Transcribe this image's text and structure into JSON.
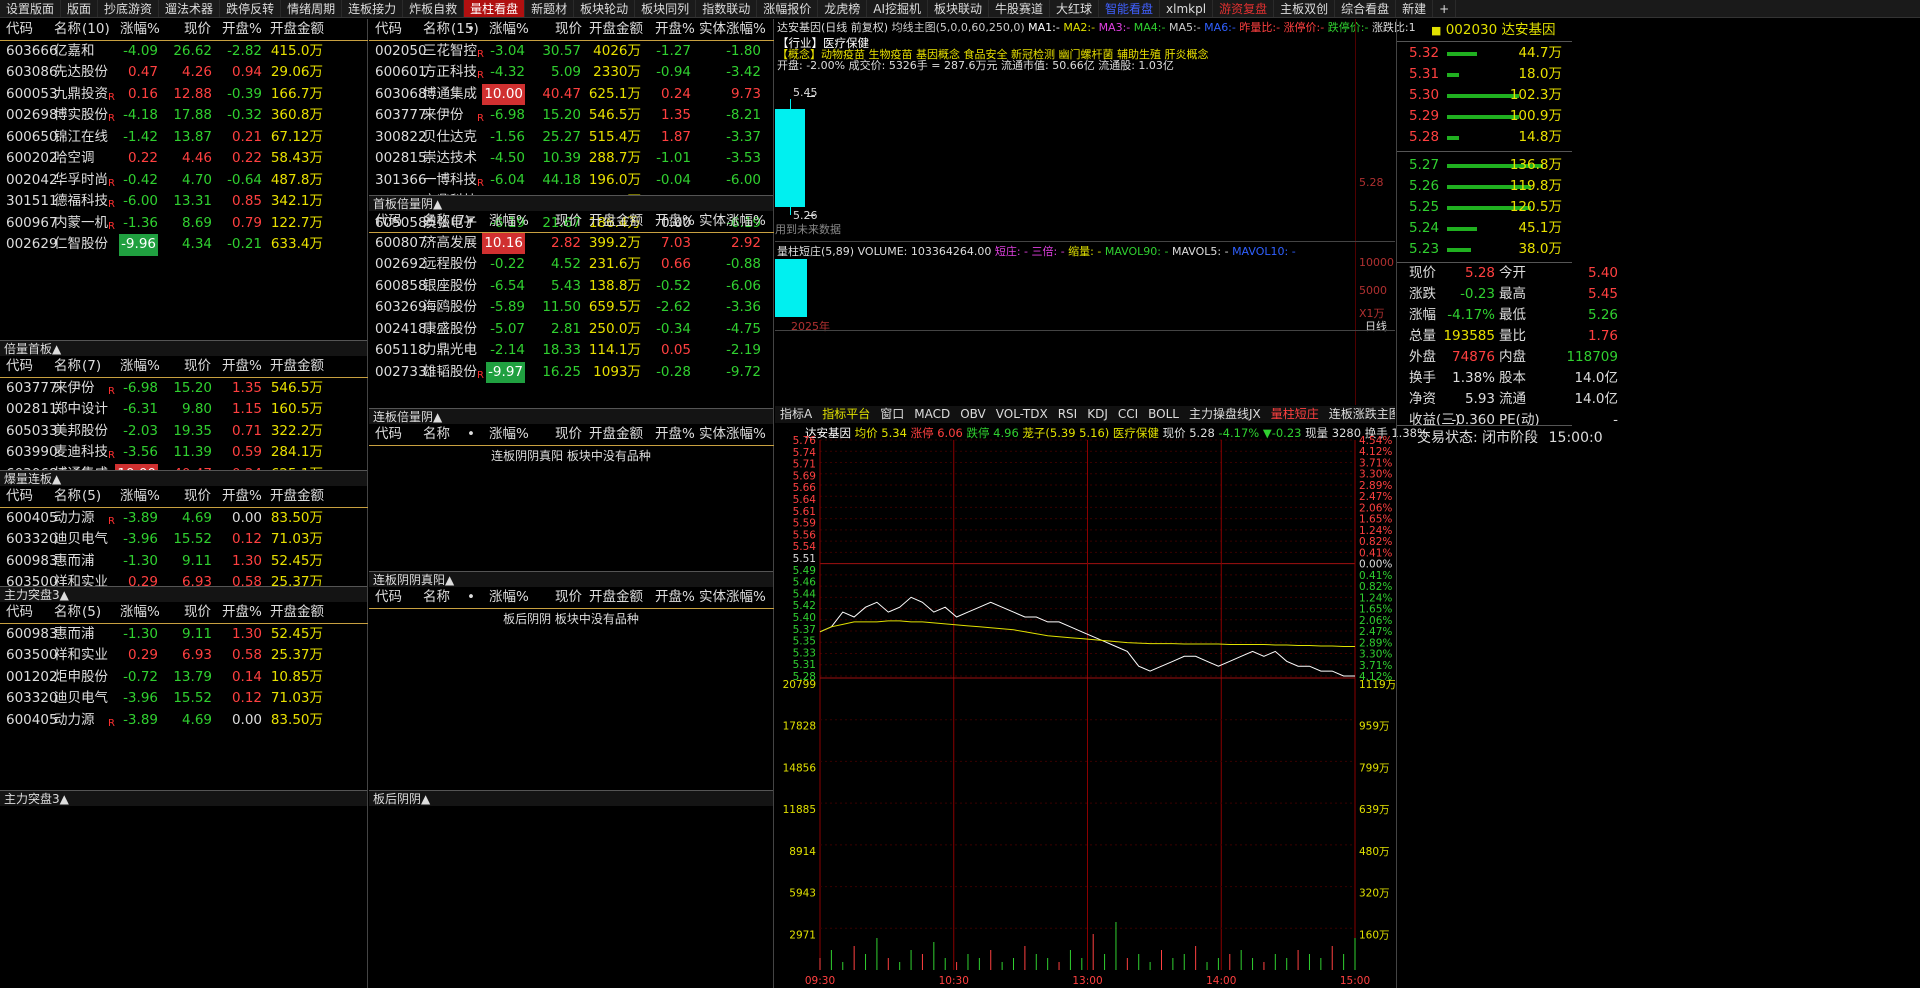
{
  "topbar": {
    "tabs": [
      "设置版面",
      "版面",
      "抄底游资",
      "遛法术器",
      "跌停反转",
      "情绪周期",
      "连板接力",
      "炸板自救",
      "量柱看盘",
      "新题材",
      "板块轮动",
      "板块同列",
      "指数联动",
      "涨幅报价",
      "龙虎榜",
      "AI挖掘机",
      "板块联动",
      "牛股赛道",
      "大红球",
      "智能看盘",
      "xlmkpl",
      "游资复盘",
      "主板双创",
      "综合看盘",
      "新建",
      "+"
    ]
  },
  "hdr": {
    "code": "代码",
    "name": "名称",
    "chg": "涨幅%",
    "price": "现价",
    "open": "开盘%",
    "amt": "开盘金额",
    "body": "实体涨幅%",
    "dot": "•"
  },
  "p1": {
    "count": "(10)",
    "rows": [
      [
        "603666",
        "亿嘉和",
        "",
        "-4.09",
        "26.62",
        "-2.82",
        "415.0万"
      ],
      [
        "603086",
        "先达股份",
        "",
        "0.47",
        "4.26",
        "0.94",
        "29.06万"
      ],
      [
        "600053",
        "九鼎投资",
        "R",
        "0.16",
        "12.88",
        "-0.39",
        "166.7万"
      ],
      [
        "002698",
        "博实股份",
        "R",
        "-4.18",
        "17.88",
        "-0.32",
        "360.8万"
      ],
      [
        "600650",
        "锦江在线",
        "",
        "-1.42",
        "13.87",
        "0.21",
        "67.12万"
      ],
      [
        "600202",
        "哈空调",
        "",
        "0.22",
        "4.46",
        "0.22",
        "58.43万"
      ],
      [
        "002042",
        "华孚时尚",
        "R",
        "-0.42",
        "4.70",
        "-0.64",
        "487.8万"
      ],
      [
        "301511",
        "德福科技",
        "R",
        "-6.00",
        "13.31",
        "0.85",
        "342.1万"
      ],
      [
        "600967",
        "内蒙一机",
        "R",
        "-1.36",
        "8.69",
        "0.79",
        "122.7万"
      ],
      [
        "002629",
        "仁智股份",
        "",
        "-9.96",
        "4.34",
        "-0.21",
        "633.4万"
      ]
    ]
  },
  "p2": {
    "title": "倍量首板▲",
    "count": "(7)",
    "rows": [
      [
        "603777",
        "来伊份",
        "R",
        "-6.98",
        "15.20",
        "1.35",
        "546.5万"
      ],
      [
        "002811",
        "郑中设计",
        "",
        "-6.31",
        "9.80",
        "1.15",
        "160.5万"
      ],
      [
        "605033",
        "美邦股份",
        "",
        "-2.03",
        "19.35",
        "0.71",
        "322.2万"
      ],
      [
        "603990",
        "麦迪科技",
        "R",
        "-3.56",
        "11.39",
        "0.59",
        "284.1万"
      ],
      [
        "603068",
        "博通集成",
        "",
        "10.00",
        "40.47",
        "0.24",
        "625.1万"
      ]
    ]
  },
  "p3": {
    "title": "爆量连板▲",
    "count": "(5)",
    "rows": [
      [
        "600405",
        "动力源",
        "R",
        "-3.89",
        "4.69",
        "0.00",
        "83.50万"
      ],
      [
        "603320",
        "迪贝电气",
        "",
        "-3.96",
        "15.52",
        "0.12",
        "71.03万"
      ],
      [
        "600983",
        "惠而浦",
        "",
        "-1.30",
        "9.11",
        "1.30",
        "52.45万"
      ],
      [
        "603500",
        "祥和实业",
        "",
        "0.29",
        "6.93",
        "0.58",
        "25.37万"
      ]
    ]
  },
  "p4": {
    "title": "主力突盘3▲",
    "count": "(5)",
    "rows": [
      [
        "600983",
        "惠而浦",
        "",
        "-1.30",
        "9.11",
        "1.30",
        "52.45万"
      ],
      [
        "603500",
        "祥和实业",
        "",
        "0.29",
        "6.93",
        "0.58",
        "25.37万"
      ],
      [
        "001202",
        "炬申股份",
        "",
        "-0.72",
        "13.79",
        "0.14",
        "10.85万"
      ],
      [
        "603320",
        "迪贝电气",
        "",
        "-3.96",
        "15.52",
        "0.12",
        "71.03万"
      ],
      [
        "600405",
        "动力源",
        "R",
        "-3.89",
        "4.69",
        "0.00",
        "83.50万"
      ]
    ]
  },
  "p4b": {
    "title": "主力突盘3▲"
  },
  "m1": {
    "count": "(15)",
    "rows": [
      [
        "002050",
        "三花智控",
        "R",
        "-3.04",
        "30.57",
        "4026万",
        "-1.27",
        "-1.80"
      ],
      [
        "600601",
        "方正科技",
        "R",
        "-4.32",
        "5.09",
        "2330万",
        "-0.94",
        "-3.42"
      ],
      [
        "603068",
        "博通集成",
        "",
        "10.00",
        "40.47",
        "625.1万",
        "0.24",
        "9.73"
      ],
      [
        "603777",
        "来伊份",
        "R",
        "-6.98",
        "15.20",
        "546.5万",
        "1.35",
        "-8.21"
      ],
      [
        "300822",
        "贝仕达克",
        "",
        "-1.56",
        "25.27",
        "515.4万",
        "1.87",
        "-3.37"
      ],
      [
        "002815",
        "崇达技术",
        "",
        "-4.50",
        "10.39",
        "288.7万",
        "-1.01",
        "-3.53"
      ],
      [
        "301366",
        "一博科技",
        "R",
        "-6.04",
        "44.18",
        "196.0万",
        "-0.04",
        "-6.00"
      ],
      [
        "002552",
        "宝鼎科技",
        "R",
        "-8.47",
        "14.70",
        "192.1万",
        "-1.06",
        "-7.49"
      ],
      [
        "605058",
        "澳弘电子",
        "",
        "-6.19",
        "21.67",
        "186.4万",
        "0.00",
        "-6.19"
      ]
    ]
  },
  "m2": {
    "title": "首板倍量阴▲",
    "count": "(7)",
    "rows": [
      [
        "600807",
        "济高发展",
        "",
        "10.16",
        "2.82",
        "399.2万",
        "7.03",
        "2.92"
      ],
      [
        "002692",
        "远程股份",
        "",
        "-0.22",
        "4.52",
        "231.6万",
        "0.66",
        "-0.88"
      ],
      [
        "600858",
        "银座股份",
        "",
        "-6.54",
        "5.43",
        "138.8万",
        "-0.52",
        "-6.06"
      ],
      [
        "603269",
        "海鸥股份",
        "",
        "-5.89",
        "11.50",
        "659.5万",
        "-2.62",
        "-3.36"
      ],
      [
        "002418",
        "康盛股份",
        "",
        "-5.07",
        "2.81",
        "250.0万",
        "-0.34",
        "-4.75"
      ],
      [
        "605118",
        "力鼎光电",
        "",
        "-2.14",
        "18.33",
        "114.1万",
        "0.05",
        "-2.19"
      ],
      [
        "002733",
        "雄韬股份",
        "R",
        "-9.97",
        "16.25",
        "1093万",
        "-0.28",
        "-9.72"
      ]
    ]
  },
  "m3": {
    "title": "连板倍量阴▲",
    "empty": "连板阴阴真阳 板块中没有品种"
  },
  "m4": {
    "title": "连板阴阴真阳▲",
    "empty": "板后阴阴 板块中没有品种"
  },
  "m5": {
    "title": "板后阴阴▲"
  },
  "kline": {
    "title": "达安基因(日线 前复权)",
    "ma": "均线主图(5,0,0,60,250,0)",
    "ma1": "MA1:-",
    "ma2": "MA2:-",
    "ma3": "MA3:-",
    "ma4": "MA4:-",
    "ma5": "MA5:-",
    "ma6": "MA6:-",
    "lb": "昨量比:-",
    "zt": "涨停价:-",
    "dt": "跌停价:-",
    "zdl": "涨跌比:1",
    "ind": "【行业】医疗保健",
    "concept": "【概念】动物疫苗 生物疫苗 基因概念 食品安全 新冠检测 幽门螺杆菌 辅助生殖 肝炎概念",
    "info": "开盘: -2.00%  成交价: 5326手 = 287.6万元  流通市值: 50.66亿  流通股: 1.03亿",
    "hi": "5.45",
    "lo": "5.26",
    "axis": "5.28",
    "future": "用到未来数据",
    "year": "2025年"
  },
  "vol": {
    "title": "量柱短庄(5,89)",
    "v": "VOLUME: 103364264.00",
    "a1": "短庄: -",
    "a2": "三倍: -",
    "a3": "缩量: -",
    "a4": "MAVOL90: -",
    "a5": "MAVOL5: -",
    "a6": "MAVOL10: -",
    "tick": "10000",
    "tick2": "5000",
    "unit": "X1万",
    "freq": "日线"
  },
  "itabs": [
    "指标A",
    "指标平台",
    "窗口",
    "MACD",
    "OBV",
    "VOL-TDX",
    "RSI",
    "KDJ",
    "CCI",
    "BOLL",
    "主力操盘线JX",
    "量柱短庄",
    "连板涨跌主图",
    ">",
    "指标B",
    "模板",
    "+",
    "-",
    "0"
  ],
  "intraday": {
    "name": "达安基因",
    "avg": "均价 5.34",
    "zt": "涨停 6.06",
    "dt": "跌停 4.96",
    "cs": "茏子(5.39 5.16)",
    "ind": "医疗保健",
    "now": "现价 5.28",
    "chg": "-4.17%",
    "d": "-0.23",
    "vol": "现量 3280",
    "hs": "换手 1.38%",
    "left": [
      "5.76",
      "5.74",
      "5.71",
      "5.69",
      "5.66",
      "5.64",
      "5.61",
      "5.59",
      "5.56",
      "5.54",
      "5.51",
      "5.49",
      "5.46",
      "5.44",
      "5.42",
      "5.40",
      "5.37",
      "5.35",
      "5.33",
      "5.31",
      "5.28"
    ],
    "right": [
      "4.54%",
      "4.12%",
      "3.71%",
      "3.30%",
      "2.89%",
      "2.47%",
      "2.06%",
      "1.65%",
      "1.24%",
      "0.82%",
      "0.41%",
      "0.00%",
      "0.41%",
      "0.82%",
      "1.24%",
      "1.65%",
      "2.06%",
      "2.47%",
      "2.89%",
      "3.30%",
      "3.71%",
      "4.12%"
    ],
    "vleft": [
      "20799",
      "17828",
      "14856",
      "11885",
      "8914",
      "5943",
      "2971"
    ],
    "vright": [
      "1119万",
      "959万",
      "799万",
      "639万",
      "480万",
      "320万",
      "160万"
    ],
    "times": [
      "09:30",
      "10:30",
      "13:00",
      "14:00",
      "15:00"
    ],
    "price": [
      5.37,
      5.38,
      5.41,
      5.4,
      5.42,
      5.43,
      5.41,
      5.42,
      5.44,
      5.43,
      5.41,
      5.42,
      5.4,
      5.41,
      5.42,
      5.43,
      5.42,
      5.41,
      5.4,
      5.4,
      5.39,
      5.39,
      5.38,
      5.37,
      5.36,
      5.35,
      5.34,
      5.33,
      5.3,
      5.29,
      5.3,
      5.31,
      5.32,
      5.32,
      5.31,
      5.3,
      5.31,
      5.32,
      5.33,
      5.32,
      5.33,
      5.31,
      5.3,
      5.3,
      5.29,
      5.29,
      5.28,
      5.28
    ],
    "avgline": [
      5.37,
      5.38,
      5.385,
      5.39,
      5.39,
      5.39,
      5.392,
      5.392,
      5.39,
      5.39,
      5.388,
      5.386,
      5.384,
      5.382,
      5.38,
      5.378,
      5.376,
      5.374,
      5.37,
      5.366,
      5.362,
      5.36,
      5.358,
      5.356,
      5.354,
      5.352,
      5.35,
      5.348,
      5.347,
      5.346,
      5.346,
      5.346,
      5.345,
      5.345,
      5.345,
      5.345,
      5.344,
      5.344,
      5.344,
      5.344,
      5.343,
      5.343,
      5.342,
      5.342,
      5.341,
      5.341,
      5.34,
      5.34
    ]
  },
  "quote": {
    "code": "002030",
    "name": "达安基因",
    "asks": [
      [
        "5.32",
        "44.7万",
        0.05
      ],
      [
        "5.31",
        "18.0万",
        0.02
      ],
      [
        "5.30",
        "102.3万",
        0.12
      ],
      [
        "5.29",
        "100.9万",
        0.12
      ],
      [
        "5.28",
        "14.8万",
        0.02
      ]
    ],
    "bids": [
      [
        "5.27",
        "136.8万",
        0.16
      ],
      [
        "5.26",
        "119.8万",
        0.14
      ],
      [
        "5.25",
        "120.5万",
        0.14
      ],
      [
        "5.24",
        "45.1万",
        0.05
      ],
      [
        "5.23",
        "38.0万",
        0.04
      ]
    ],
    "stats": [
      [
        "现价",
        "5.28",
        "今开",
        "5.40"
      ],
      [
        "涨跌",
        "-0.23",
        "最高",
        "5.45"
      ],
      [
        "涨幅",
        "-4.17%",
        "最低",
        "5.26"
      ],
      [
        "总量",
        "193585",
        "量比",
        "1.76"
      ],
      [
        "外盘",
        "74876",
        "内盘",
        "118709"
      ],
      [
        "换手",
        "1.38%",
        "股本",
        "14.0亿"
      ],
      [
        "净资",
        "5.93",
        "流通",
        "14.0亿"
      ],
      [
        "收益(三)",
        "-0.360",
        "PE(动)",
        "-"
      ]
    ],
    "status": "交易状态: 闭市阶段",
    "time": "15:00:0"
  }
}
